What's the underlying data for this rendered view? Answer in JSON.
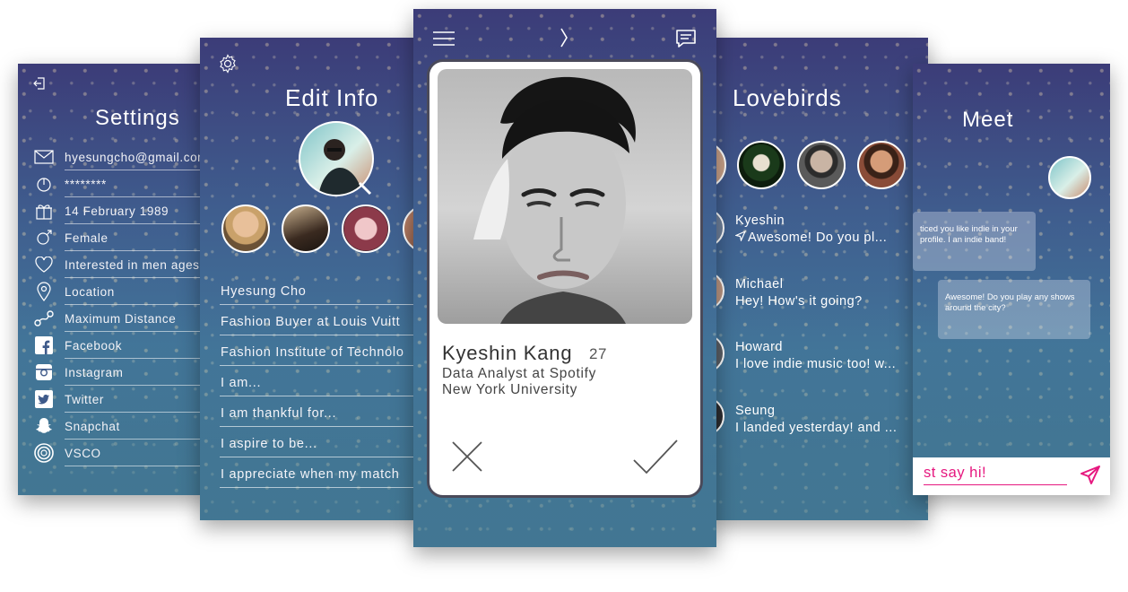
{
  "colors": {
    "accent_pink": "#e6187f",
    "card_border": "#4a4a5a",
    "bg_top": "#3c3c78",
    "bg_bottom": "#3d6f8f"
  },
  "settings": {
    "title": "Settings",
    "items": [
      {
        "icon": "email-icon",
        "label": "hyesungcho@gmail.com"
      },
      {
        "icon": "lock-icon",
        "label": "********"
      },
      {
        "icon": "gift-icon",
        "label": "14 February 1989"
      },
      {
        "icon": "gender-icon",
        "label": "Female"
      },
      {
        "icon": "heart-icon",
        "label": "Interested in men ages"
      },
      {
        "icon": "location-pin-icon",
        "label": "Location"
      },
      {
        "icon": "route-icon",
        "label": "Maximum Distance"
      },
      {
        "icon": "facebook-icon",
        "label": "Facebook"
      },
      {
        "icon": "instagram-icon",
        "label": "Instagram"
      },
      {
        "icon": "twitter-icon",
        "label": "Twitter"
      },
      {
        "icon": "snapchat-icon",
        "label": "Snapchat"
      },
      {
        "icon": "vsco-icon",
        "label": "VSCO"
      }
    ]
  },
  "edit_info": {
    "title": "Edit Info",
    "fields": [
      "Hyesung Cho",
      "Fashion Buyer at Louis Vuitt",
      "Fashion Institute of Technolo",
      "I am...",
      "I am thankful for...",
      "I aspire to be...",
      "I appreciate when my match"
    ]
  },
  "profile": {
    "name": "Kyeshin Kang",
    "age": "27",
    "job": "Data Analyst at Spotify",
    "school": "New York University"
  },
  "lovebirds": {
    "title": "Lovebirds",
    "chats": [
      {
        "name": "Kyeshin",
        "message": "Awesome! Do you pl..."
      },
      {
        "name": "Michael",
        "message": "Hey! How's it going?"
      },
      {
        "name": "Howard",
        "message": "I love indie music too! w..."
      },
      {
        "name": "Seung",
        "message": "I landed yesterday! and ..."
      }
    ]
  },
  "meet": {
    "title": "Meet",
    "bubble_1": "ticed you like indie in your profile. I an indie band!",
    "bubble_2": "Awesome! Do you play any shows around the city?",
    "input_text": "st say hi!"
  }
}
